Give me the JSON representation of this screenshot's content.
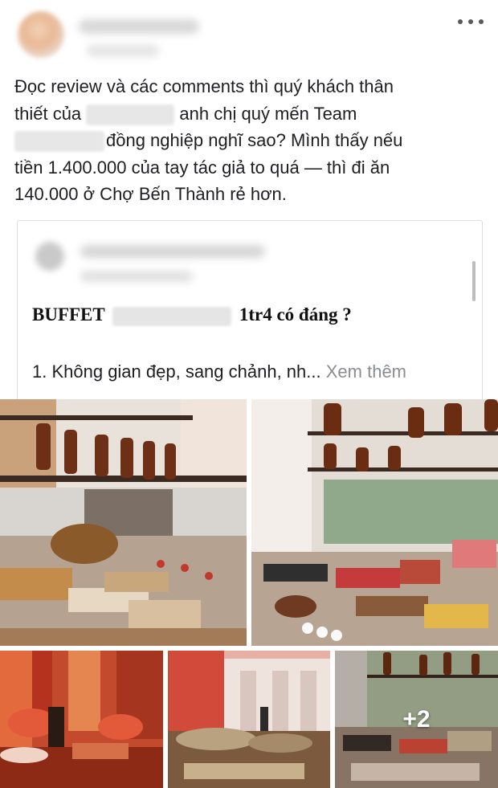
{
  "post": {
    "text_line1": "Đọc review và các comments thì quý khách thân",
    "text_line2_a": "thiết của",
    "text_line2_b": "anh chị quý mến Team",
    "text_line3": "đồng nghiệp nghĩ sao? Mình thấy nếu",
    "text_line4": "tiền 1.400.000 của tay tác giả to quá — thì đi ăn",
    "text_line5": "140.000 ở Chợ Bến Thành rẻ hơn."
  },
  "shared_post": {
    "title_start": "BUFFET",
    "title_end": "1tr4 có đáng ?",
    "first_line": "1. Không gian đẹp, sang chảnh, nh...",
    "see_more": "Xem thêm"
  },
  "gallery": {
    "more_count": "+2"
  },
  "icons": {
    "more": "more-horizontal-icon"
  }
}
